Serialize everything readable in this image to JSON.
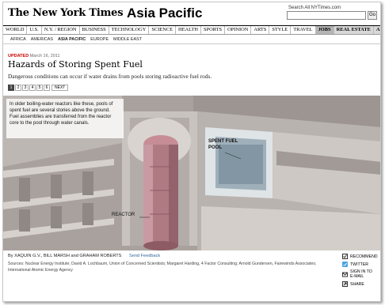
{
  "masthead": {
    "logo": "The New York Times",
    "section_title": "Asia Pacific",
    "search_label": "Search All NYTimes.com",
    "search_placeholder": "",
    "go_label": "Go"
  },
  "nav": {
    "items": [
      "WORLD",
      "U.S.",
      "N.Y. / REGION",
      "BUSINESS",
      "TECHNOLOGY",
      "SCIENCE",
      "HEALTH",
      "SPORTS",
      "OPINION",
      "ARTS",
      "STYLE",
      "TRAVEL",
      "JOBS",
      "REAL ESTATE",
      "AUTOS"
    ],
    "active": "JOBS"
  },
  "subnav": {
    "items": [
      "AFRICA",
      "AMERICAS",
      "ASIA PACIFIC",
      "EUROPE",
      "MIDDLE EAST"
    ],
    "active": "ASIA PACIFIC"
  },
  "article": {
    "updated_label": "UPDATED",
    "date": "March 16, 2011",
    "headline": "Hazards of Storing Spent Fuel",
    "dek": "Dangerous conditions can occur if water drains from pools storing radioactive fuel rods."
  },
  "pager": {
    "pages": [
      "1",
      "2",
      "3",
      "4",
      "5",
      "6"
    ],
    "current": "1",
    "next_label": "NEXT"
  },
  "graphic": {
    "caption": "In older boiling-water reactors like these, pools of spent fuel are several stories above the ground. Fuel assemblies are transferred from the reactor core to the pool through water canals.",
    "label_pool_line1": "SPENT FUEL",
    "label_pool_line2": "POOL",
    "label_reactor": "REACTOR"
  },
  "footer": {
    "byline": "By XAQUIN G.V., BILL MARSH and GRAHAM ROBERTS",
    "send_feedback": "Send Feedback",
    "sources": "Sources: Nuclear Energy Institute; David A. Lochbaum, Union of Concerned Scientists; Margaret Harding, 4 Factor Consulting; Arnold Gundersen, Fairewinds Associates; International Atomic Energy Agency"
  },
  "tools": {
    "recommend": "RECOMMEND",
    "twitter": "TWITTER",
    "sign_in_line1": "SIGN IN TO",
    "sign_in_line2": "E-MAIL",
    "share": "SHARE"
  },
  "colors": {
    "updated_red": "#cc0000",
    "link_blue": "#336699",
    "reactor_pink": "#b07a83"
  }
}
